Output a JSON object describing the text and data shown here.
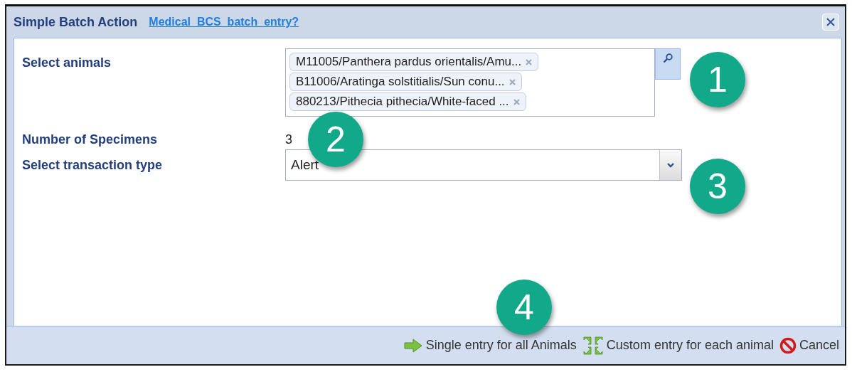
{
  "dialog": {
    "title": "Simple Batch Action",
    "link": "Medical  BCS  batch  entry?"
  },
  "form": {
    "animals_label": "Select animals",
    "animals": [
      {
        "text": "M11005/Panthera pardus orientalis/Amu..."
      },
      {
        "text": "B11006/Aratinga solstitialis/Sun conu..."
      },
      {
        "text": "880213/Pithecia pithecia/White-faced ..."
      }
    ],
    "count_label": "Number of Specimens",
    "count": "3",
    "type_label": "Select transaction type",
    "type_value": "Alert"
  },
  "buttons": [
    {
      "kind": "single",
      "label": "Single entry for all Animals"
    },
    {
      "kind": "custom",
      "label": "Custom entry for each animal"
    },
    {
      "kind": "cancel",
      "label": "Cancel"
    }
  ],
  "callouts": [
    "1",
    "2",
    "3",
    "4"
  ]
}
